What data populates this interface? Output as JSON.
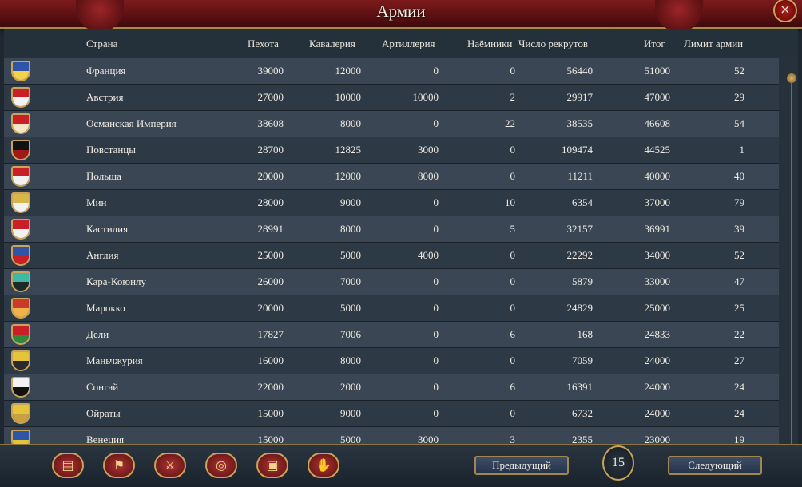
{
  "window": {
    "title": "Армии",
    "close_icon": "×"
  },
  "columns": {
    "country": "Страна",
    "infantry": "Пехота",
    "cavalry": "Кавалерия",
    "artillery": "Артиллерия",
    "mercenaries": "Наёмники",
    "manpower": "Число рекрутов",
    "total": "Итог",
    "limit": "Лимит армии"
  },
  "rows": [
    {
      "flag": [
        "#2e55a8",
        "#f1d24a"
      ],
      "country": "Франция",
      "infantry": "39000",
      "cavalry": "12000",
      "artillery": "0",
      "mercenaries": "0",
      "manpower": "56440",
      "total": "51000",
      "limit": "52"
    },
    {
      "flag": [
        "#c92028",
        "#f2f2f2"
      ],
      "country": "Австрия",
      "infantry": "27000",
      "cavalry": "10000",
      "artillery": "10000",
      "mercenaries": "2",
      "manpower": "29917",
      "total": "47000",
      "limit": "29"
    },
    {
      "flag": [
        "#c92028",
        "#f4e7c8"
      ],
      "country": "Османская Империя",
      "infantry": "38608",
      "cavalry": "8000",
      "artillery": "0",
      "mercenaries": "22",
      "manpower": "38535",
      "total": "46608",
      "limit": "54"
    },
    {
      "flag": [
        "#111111",
        "#a01818"
      ],
      "country": "Повстанцы",
      "infantry": "28700",
      "cavalry": "12825",
      "artillery": "3000",
      "mercenaries": "0",
      "manpower": "109474",
      "total": "44525",
      "limit": "1"
    },
    {
      "flag": [
        "#c92028",
        "#f2f2f2"
      ],
      "country": "Польша",
      "infantry": "20000",
      "cavalry": "12000",
      "artillery": "8000",
      "mercenaries": "0",
      "manpower": "11211",
      "total": "40000",
      "limit": "40"
    },
    {
      "flag": [
        "#d9b64a",
        "#f2f2f2"
      ],
      "country": "Мин",
      "infantry": "28000",
      "cavalry": "9000",
      "artillery": "0",
      "mercenaries": "10",
      "manpower": "6354",
      "total": "37000",
      "limit": "79"
    },
    {
      "flag": [
        "#c92028",
        "#f2f2f2"
      ],
      "country": "Кастилия",
      "infantry": "28991",
      "cavalry": "8000",
      "artillery": "0",
      "mercenaries": "5",
      "manpower": "32157",
      "total": "36991",
      "limit": "39"
    },
    {
      "flag": [
        "#2e55a8",
        "#c92028"
      ],
      "country": "Англия",
      "infantry": "25000",
      "cavalry": "5000",
      "artillery": "4000",
      "mercenaries": "0",
      "manpower": "22292",
      "total": "34000",
      "limit": "52"
    },
    {
      "flag": [
        "#3fb8a6",
        "#1d2a2a"
      ],
      "country": "Кара-Коюнлу",
      "infantry": "26000",
      "cavalry": "7000",
      "artillery": "0",
      "mercenaries": "0",
      "manpower": "5879",
      "total": "33000",
      "limit": "47"
    },
    {
      "flag": [
        "#c93a2a",
        "#f1b24a"
      ],
      "country": "Марокко",
      "infantry": "20000",
      "cavalry": "5000",
      "artillery": "0",
      "mercenaries": "0",
      "manpower": "24829",
      "total": "25000",
      "limit": "25"
    },
    {
      "flag": [
        "#c92028",
        "#2e8a3a"
      ],
      "country": "Дели",
      "infantry": "17827",
      "cavalry": "7006",
      "artillery": "0",
      "mercenaries": "6",
      "manpower": "168",
      "total": "24833",
      "limit": "22"
    },
    {
      "flag": [
        "#e3c43a",
        "#2a2a2a"
      ],
      "country": "Маньчжурия",
      "infantry": "16000",
      "cavalry": "8000",
      "artillery": "0",
      "mercenaries": "0",
      "manpower": "7059",
      "total": "24000",
      "limit": "27"
    },
    {
      "flag": [
        "#f2f2f2",
        "#111111"
      ],
      "country": "Сонгай",
      "infantry": "22000",
      "cavalry": "2000",
      "artillery": "0",
      "mercenaries": "6",
      "manpower": "16391",
      "total": "24000",
      "limit": "24"
    },
    {
      "flag": [
        "#e3c43a",
        "#c9a040"
      ],
      "country": "Ойраты",
      "infantry": "15000",
      "cavalry": "9000",
      "artillery": "0",
      "mercenaries": "0",
      "manpower": "6732",
      "total": "24000",
      "limit": "24"
    },
    {
      "flag": [
        "#2e55a8",
        "#e3c43a"
      ],
      "country": "Венеция",
      "infantry": "15000",
      "cavalry": "5000",
      "artillery": "3000",
      "mercenaries": "3",
      "manpower": "2355",
      "total": "23000",
      "limit": "19"
    }
  ],
  "footer": {
    "tools": [
      {
        "name": "ledger-icon",
        "glyph": "▤"
      },
      {
        "name": "flag-icon",
        "glyph": "⚑"
      },
      {
        "name": "crossed-swords-icon",
        "glyph": "⚔"
      },
      {
        "name": "coins-icon",
        "glyph": "◎"
      },
      {
        "name": "crate-icon",
        "glyph": "▣"
      },
      {
        "name": "handshake-icon",
        "glyph": "✋"
      }
    ],
    "prev_label": "Предыдущий",
    "page": "15",
    "next_label": "Следующий"
  }
}
